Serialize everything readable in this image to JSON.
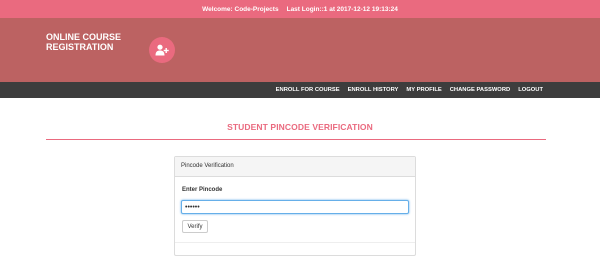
{
  "topbar": {
    "welcome": "Welcome: Code-Projects",
    "last_login": "Last Login::1 at 2017-12-12 19:13:24"
  },
  "brand": {
    "line1": "ONLINE COURSE",
    "line2": "REGISTRATION"
  },
  "logo": {
    "icon": "user-plus-icon"
  },
  "nav": {
    "items": [
      {
        "label": "ENROLL FOR COURSE"
      },
      {
        "label": "ENROLL HISTORY"
      },
      {
        "label": "MY PROFILE"
      },
      {
        "label": "CHANGE PASSWORD"
      },
      {
        "label": "LOGOUT"
      }
    ]
  },
  "page": {
    "title": "STUDENT PINCODE VERIFICATION"
  },
  "panel": {
    "heading": "Pincode Verification",
    "pincode_label": "Enter Pincode",
    "pincode_value": "••••••",
    "verify_label": "Verify"
  },
  "colors": {
    "accent": "#ea6a7f",
    "header_bg": "#bc6262",
    "navbar_bg": "#3d3d3d"
  }
}
